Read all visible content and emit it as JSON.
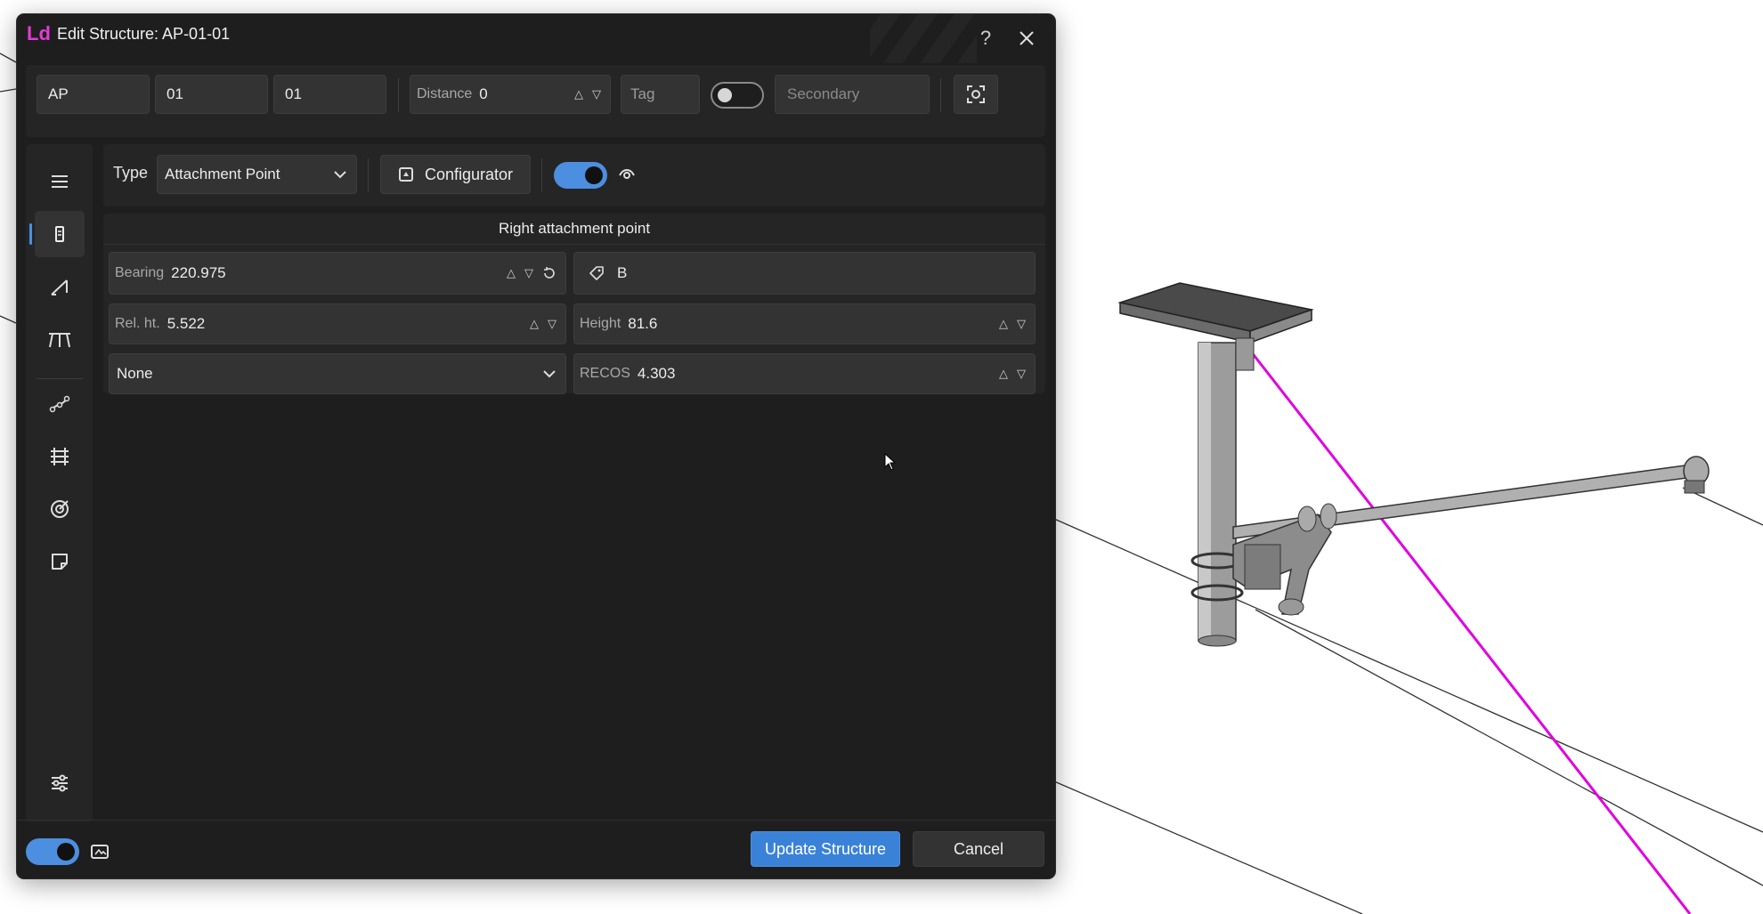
{
  "window": {
    "logo": "Ld",
    "title": "Edit Structure: AP-01-01"
  },
  "topbar": {
    "code1": "AP",
    "code2": "01",
    "code3": "01",
    "distance_label": "Distance",
    "distance_value": "0",
    "tag_placeholder": "Tag",
    "secondary_toggle": "off",
    "secondary_placeholder": "Secondary"
  },
  "type_row": {
    "type_label": "Type",
    "type_value": "Attachment Point",
    "configurator_label": "Configurator",
    "visibility_toggle": "on"
  },
  "attachment": {
    "section_title": "Right attachment point",
    "bearing_label": "Bearing",
    "bearing_value": "220.975",
    "tag_value": "B",
    "rel_ht_label": "Rel. ht.",
    "rel_ht_value": "5.522",
    "height_label": "Height",
    "height_value": "81.6",
    "mode_select": "None",
    "recos_label": "RECOS",
    "recos_value": "4.303"
  },
  "footer": {
    "auto_toggle": "on",
    "update_label": "Update Structure",
    "cancel_label": "Cancel"
  },
  "colors": {
    "accent": "#4c8fe0",
    "logo": "#e23bd5",
    "wire": "#e000e0"
  },
  "icons": [
    "help-icon",
    "close-icon",
    "screenshot-icon",
    "hamburger-icon",
    "structure-icon",
    "span-icon",
    "crossarm-icon",
    "wire-icon",
    "track-icon",
    "target-icon",
    "note-icon",
    "settings-icon",
    "configurator-icon",
    "eye-icon",
    "tag-icon",
    "reset-icon"
  ]
}
